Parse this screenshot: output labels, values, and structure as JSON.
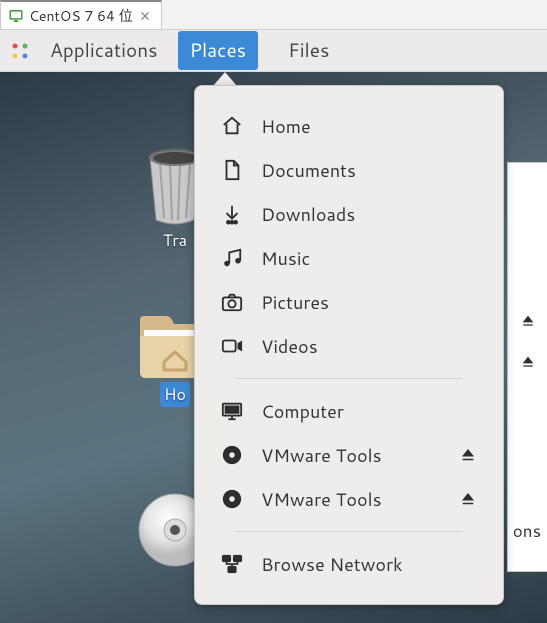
{
  "window_tab": {
    "title": "CentOS 7 64 位"
  },
  "top_bar": {
    "applications": "Applications",
    "places": "Places",
    "files": "Files"
  },
  "desktop": {
    "trash_label": "Tra",
    "home_label": "Ho",
    "disc_label": ""
  },
  "places_menu": {
    "home": "Home",
    "documents": "Documents",
    "downloads": "Downloads",
    "music": "Music",
    "pictures": "Pictures",
    "videos": "Videos",
    "computer": "Computer",
    "vmware_tools_1": "VMware Tools",
    "vmware_tools_2": "VMware Tools",
    "browse_network": "Browse Network"
  },
  "right_panel_text": "ons"
}
